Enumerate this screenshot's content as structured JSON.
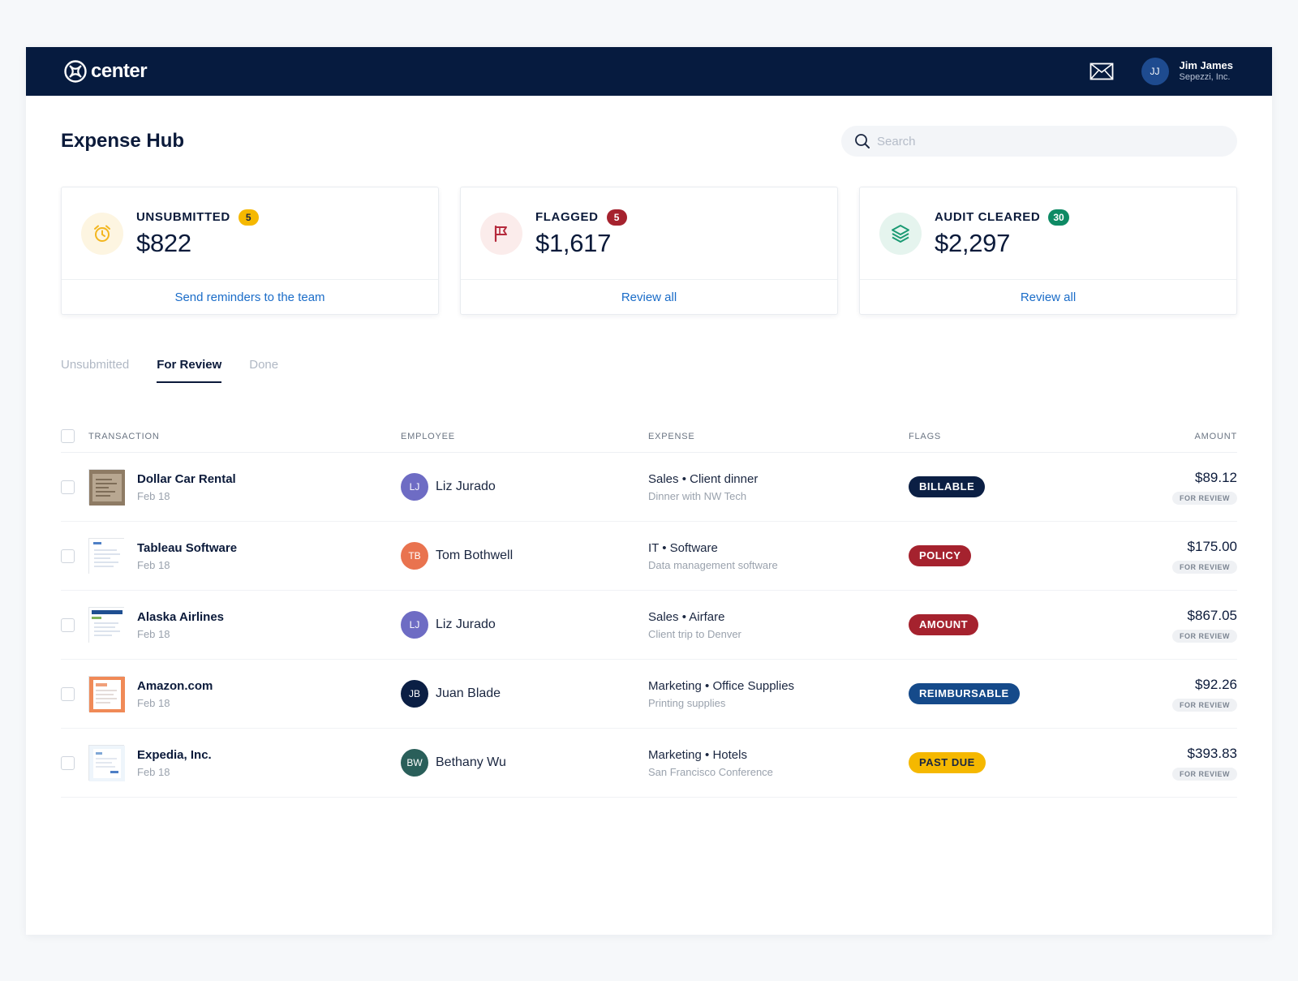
{
  "app": {
    "logo_text": "center",
    "user": {
      "initials": "JJ",
      "name": "Jim James",
      "company": "Sepezzi, Inc."
    }
  },
  "page": {
    "title": "Expense Hub"
  },
  "search": {
    "placeholder": "Search",
    "value": ""
  },
  "cards": [
    {
      "label": "UNSUBMITTED",
      "count": "5",
      "amount": "$822",
      "link": "Send reminders to the team",
      "icon": "alarm-clock-icon",
      "icon_color": "#f3b61f",
      "badge_bg": "#f5b800",
      "badge_fg": "#1a2640"
    },
    {
      "label": "FLAGGED",
      "count": "5",
      "amount": "$1,617",
      "link": "Review all",
      "icon": "flag-icon",
      "icon_color": "#b52a3c",
      "badge_bg": "#a5222e",
      "badge_fg": "#ffffff"
    },
    {
      "label": "AUDIT CLEARED",
      "count": "30",
      "amount": "$2,297",
      "link": "Review all",
      "icon": "layers-icon",
      "icon_color": "#1a9a73",
      "badge_bg": "#0e8a64",
      "badge_fg": "#ffffff"
    }
  ],
  "tabs": [
    {
      "label": "Unsubmitted",
      "active": false
    },
    {
      "label": "For Review",
      "active": true
    },
    {
      "label": "Done",
      "active": false
    }
  ],
  "table": {
    "columns": {
      "transaction": "TRANSACTION",
      "employee": "EMPLOYEE",
      "expense": "EXPENSE",
      "flags": "FLAGS",
      "amount": "AMOUNT"
    },
    "rows": [
      {
        "merchant": "Dollar Car Rental",
        "date": "Feb 18",
        "initials": "LJ",
        "employee": "Liz Jurado",
        "avatar_color": "#6e6cc4",
        "category": "Sales • Client dinner",
        "description": "Dinner with NW Tech",
        "flag": "BILLABLE",
        "flag_bg": "#0b1f44",
        "flag_fg": "#ffffff",
        "amount": "$89.12",
        "status": "FOR REVIEW",
        "thumb": "receipt-photo"
      },
      {
        "merchant": "Tableau Software",
        "date": "Feb 18",
        "initials": "TB",
        "employee": "Tom Bothwell",
        "avatar_color": "#e9734f",
        "category": "IT • Software",
        "description": "Data management software",
        "flag": "POLICY",
        "flag_bg": "#a5222e",
        "flag_fg": "#ffffff",
        "amount": "$175.00",
        "status": "FOR REVIEW",
        "thumb": "invoice-doc"
      },
      {
        "merchant": "Alaska Airlines",
        "date": "Feb 18",
        "initials": "LJ",
        "employee": "Liz Jurado",
        "avatar_color": "#6e6cc4",
        "category": "Sales • Airfare",
        "description": "Client trip to Denver",
        "flag": "AMOUNT",
        "flag_bg": "#a5222e",
        "flag_fg": "#ffffff",
        "amount": "$867.05",
        "status": "FOR REVIEW",
        "thumb": "ticket-doc"
      },
      {
        "merchant": "Amazon.com",
        "date": "Feb 18",
        "initials": "JB",
        "employee": "Juan Blade",
        "avatar_color": "#0b1f44",
        "category": "Marketing • Office Supplies",
        "description": "Printing supplies",
        "flag": "REIMBURSABLE",
        "flag_bg": "#154a8a",
        "flag_fg": "#ffffff",
        "amount": "$92.26",
        "status": "FOR REVIEW",
        "thumb": "order-doc"
      },
      {
        "merchant": "Expedia, Inc.",
        "date": "Feb 18",
        "initials": "BW",
        "employee": "Bethany Wu",
        "avatar_color": "#2a5f5a",
        "category": "Marketing • Hotels",
        "description": "San Francisco Conference",
        "flag": "PAST DUE",
        "flag_bg": "#f5b800",
        "flag_fg": "#1a2640",
        "amount": "$393.83",
        "status": "FOR REVIEW",
        "thumb": "booking-doc"
      }
    ]
  }
}
